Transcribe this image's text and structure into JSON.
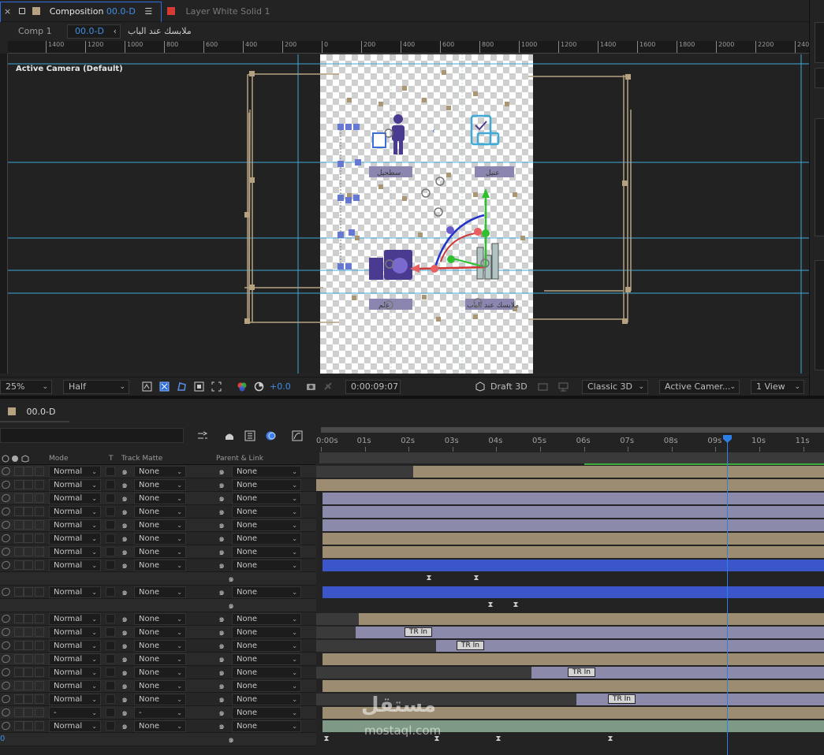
{
  "composition_panel": {
    "tab_close": "×",
    "tab_title": "Composition",
    "tab_comp_name": "00.0-D",
    "tab_menu": "☰",
    "layer_tab_label": "Layer",
    "layer_tab_name": "White Solid 1",
    "breadcrumbs": [
      "Comp 1",
      "00.0-D",
      "ملابسك عند الباب"
    ],
    "viewer_label": "Active Camera (Default)",
    "ruler_labels": [
      "1400",
      "1200",
      "1000",
      "800",
      "600",
      "400",
      "200",
      "0",
      "200",
      "400",
      "600",
      "800",
      "1000",
      "1200",
      "1400",
      "1600",
      "1800",
      "2000",
      "2200",
      "240"
    ],
    "canvas_labels": [
      "سطحيل",
      "عنيل",
      "علم",
      "ملابسك عند الباب"
    ]
  },
  "comp_footer": {
    "magnification": "25%",
    "resolution": "Half",
    "exposure": "+0.0",
    "timecode": "0:00:09:07",
    "renderer_label": "Draft 3D",
    "renderer_select": "Classic 3D",
    "camera_select": "Active Camer...",
    "view_select": "1 View"
  },
  "timeline_panel": {
    "tab_name": "00.0-D",
    "tab_menu": "☰",
    "col_mode": "Mode",
    "col_t": "T",
    "col_track_matte": "Track Matte",
    "col_parent": "Parent & Link",
    "time_ticks": [
      "0:00s",
      "01s",
      "02s",
      "03s",
      "04s",
      "05s",
      "06s",
      "07s",
      "08s",
      "09s",
      "10s",
      "11s"
    ],
    "side_digit": "0",
    "layers": [
      {
        "mode": "Normal",
        "track_matte": "None",
        "parent": "None"
      },
      {
        "mode": "Normal",
        "track_matte": "None",
        "parent": "None"
      },
      {
        "mode": "Normal",
        "track_matte": "None",
        "parent": "None"
      },
      {
        "mode": "Normal",
        "track_matte": "None",
        "parent": "None"
      },
      {
        "mode": "Normal",
        "track_matte": "None",
        "parent": "None"
      },
      {
        "mode": "Normal",
        "track_matte": "None",
        "parent": "None"
      },
      {
        "mode": "Normal",
        "track_matte": "None",
        "parent": "None"
      },
      {
        "mode": "Normal",
        "track_matte": "None",
        "parent": "None"
      },
      {
        "mode": "Normal",
        "track_matte": "None",
        "parent": "None"
      },
      {
        "mode": "Normal",
        "track_matte": "None",
        "parent": "None"
      },
      {
        "mode": "Normal",
        "track_matte": "None",
        "parent": "None"
      },
      {
        "mode": "Normal",
        "track_matte": "None",
        "parent": "None"
      },
      {
        "mode": "Normal",
        "track_matte": "None",
        "parent": "None"
      },
      {
        "mode": "Normal",
        "track_matte": "None",
        "parent": "None"
      },
      {
        "mode": "Normal",
        "track_matte": "None",
        "parent": "None"
      },
      {
        "mode": "Normal",
        "track_matte": "None",
        "parent": "None"
      },
      {
        "mode": "-",
        "track_matte": "-",
        "parent": "None"
      },
      {
        "mode": "Normal",
        "track_matte": "None",
        "parent": "None"
      }
    ],
    "bar_markers": [
      "TR In",
      "TR In",
      "TR In",
      "TR In"
    ]
  },
  "watermark": {
    "text": "مستقل",
    "sub": "mostaql.com"
  }
}
